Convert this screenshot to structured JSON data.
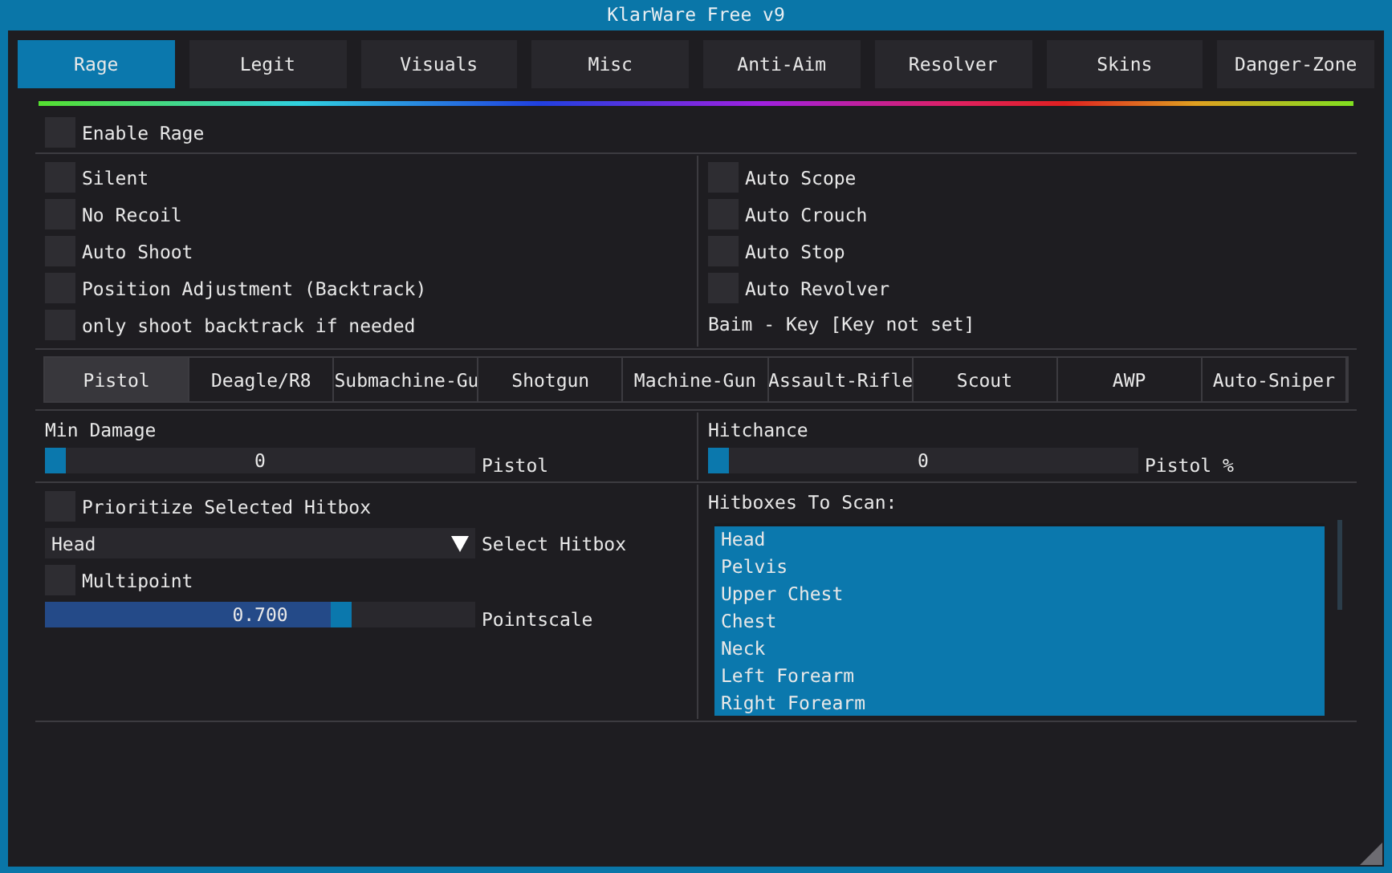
{
  "window": {
    "title": "KlarWare Free v9"
  },
  "tabs": [
    {
      "label": "Rage",
      "selected": true
    },
    {
      "label": "Legit",
      "selected": false
    },
    {
      "label": "Visuals",
      "selected": false
    },
    {
      "label": "Misc",
      "selected": false
    },
    {
      "label": "Anti-Aim",
      "selected": false
    },
    {
      "label": "Resolver",
      "selected": false
    },
    {
      "label": "Skins",
      "selected": false
    },
    {
      "label": "Danger-Zone",
      "selected": false
    }
  ],
  "enable_rage": {
    "label": "Enable Rage",
    "checked": false
  },
  "left_options": [
    {
      "label": "Silent",
      "checked": false
    },
    {
      "label": "No Recoil",
      "checked": false
    },
    {
      "label": "Auto Shoot",
      "checked": false
    },
    {
      "label": "Position Adjustment (Backtrack)",
      "checked": false
    },
    {
      "label": "only shoot backtrack if needed",
      "checked": false
    }
  ],
  "right_options": [
    {
      "label": "Auto Scope",
      "checked": false
    },
    {
      "label": "Auto Crouch",
      "checked": false
    },
    {
      "label": "Auto Stop",
      "checked": false
    },
    {
      "label": "Auto Revolver",
      "checked": false
    }
  ],
  "baim_key": "Baim - Key [Key not set]",
  "weapon_tabs": [
    {
      "label": "Pistol",
      "selected": true
    },
    {
      "label": "Deagle/R8",
      "selected": false
    },
    {
      "label": "Submachine-Gu",
      "selected": false
    },
    {
      "label": "Shotgun",
      "selected": false
    },
    {
      "label": "Machine-Gun",
      "selected": false
    },
    {
      "label": "Assault-Rifle",
      "selected": false
    },
    {
      "label": "Scout",
      "selected": false
    },
    {
      "label": "AWP",
      "selected": false
    },
    {
      "label": "Auto-Sniper",
      "selected": false
    }
  ],
  "min_damage": {
    "label": "Min Damage",
    "value": "0",
    "level": 0,
    "caption": "Pistol"
  },
  "hitchance": {
    "label": "Hitchance",
    "value": "0",
    "level": 0,
    "caption": "Pistol %"
  },
  "prioritize": {
    "label": "Prioritize Selected Hitbox",
    "checked": false
  },
  "hitbox_select": {
    "value": "Head",
    "caption": "Select Hitbox"
  },
  "multipoint": {
    "label": "Multipoint",
    "checked": false
  },
  "pointscale": {
    "value": "0.700",
    "level": 0.7,
    "caption": "Pointscale"
  },
  "hitboxes_to_scan": {
    "label": "Hitboxes To Scan:",
    "items": [
      {
        "label": "Head",
        "selected": true
      },
      {
        "label": "Pelvis",
        "selected": true
      },
      {
        "label": "Upper Chest",
        "selected": true
      },
      {
        "label": "Chest",
        "selected": true
      },
      {
        "label": "Neck",
        "selected": true
      },
      {
        "label": "Left Forearm",
        "selected": true
      },
      {
        "label": "Right Forearm",
        "selected": true
      }
    ]
  }
}
